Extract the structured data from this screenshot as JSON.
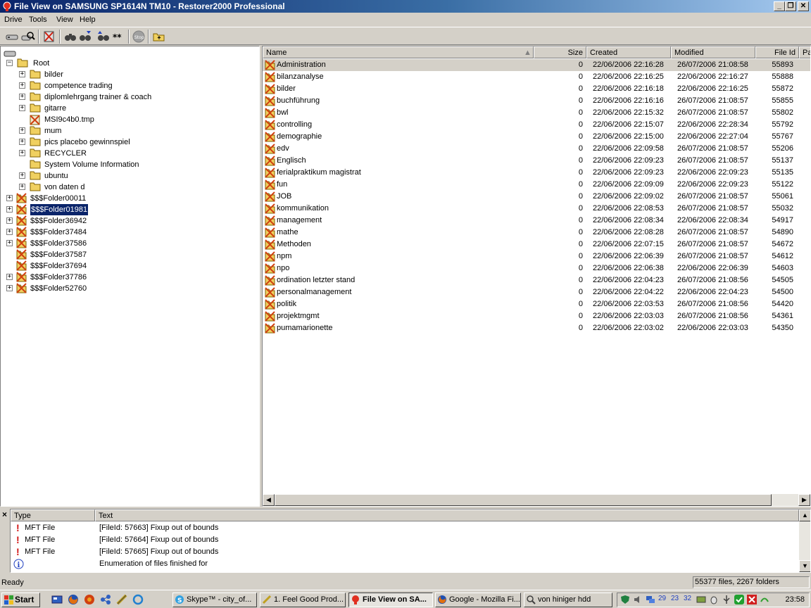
{
  "window": {
    "title": "File View  on SAMSUNG SP1614N TM10 - Restorer2000 Professional"
  },
  "menu": [
    "Drive",
    "Tools",
    "View",
    "Help"
  ],
  "tree": {
    "root": "Root",
    "root_children": [
      "bilder",
      "competence trading",
      "diplomlehrgang trainer & coach",
      "gitarre",
      "MSI9c4b0.tmp",
      "mum",
      "pics placebo gewinnspiel",
      "RECYCLER",
      "System Volume Information",
      "ubuntu",
      "von daten d"
    ],
    "lost": [
      "$$$Folder00011",
      "$$$Folder01981",
      "$$$Folder36942",
      "$$$Folder37484",
      "$$$Folder37586",
      "$$$Folder37587",
      "$$$Folder37694",
      "$$$Folder37786",
      "$$$Folder52760"
    ],
    "selected": "$$$Folder01981"
  },
  "list": {
    "columns": [
      "Name",
      "Size",
      "Created",
      "Modified",
      "File Id",
      "Pa"
    ],
    "rows": [
      [
        "Administration",
        "0",
        "22/06/2006 22:16:28",
        "26/07/2006 21:08:58",
        "55893"
      ],
      [
        "bilanzanalyse",
        "0",
        "22/06/2006 22:16:25",
        "22/06/2006 22:16:27",
        "55888"
      ],
      [
        "bilder",
        "0",
        "22/06/2006 22:16:18",
        "22/06/2006 22:16:25",
        "55872"
      ],
      [
        "buchführung",
        "0",
        "22/06/2006 22:16:16",
        "26/07/2006 21:08:57",
        "55855"
      ],
      [
        "bwl",
        "0",
        "22/06/2006 22:15:32",
        "26/07/2006 21:08:57",
        "55802"
      ],
      [
        "controlling",
        "0",
        "22/06/2006 22:15:07",
        "22/06/2006 22:28:34",
        "55792"
      ],
      [
        "demographie",
        "0",
        "22/06/2006 22:15:00",
        "22/06/2006 22:27:04",
        "55767"
      ],
      [
        "edv",
        "0",
        "22/06/2006 22:09:58",
        "26/07/2006 21:08:57",
        "55206"
      ],
      [
        "Englisch",
        "0",
        "22/06/2006 22:09:23",
        "26/07/2006 21:08:57",
        "55137"
      ],
      [
        "ferialpraktikum magistrat",
        "0",
        "22/06/2006 22:09:23",
        "22/06/2006 22:09:23",
        "55135"
      ],
      [
        "fun",
        "0",
        "22/06/2006 22:09:09",
        "22/06/2006 22:09:23",
        "55122"
      ],
      [
        "JOB",
        "0",
        "22/06/2006 22:09:02",
        "26/07/2006 21:08:57",
        "55061"
      ],
      [
        "kommunikation",
        "0",
        "22/06/2006 22:08:53",
        "26/07/2006 21:08:57",
        "55032"
      ],
      [
        "management",
        "0",
        "22/06/2006 22:08:34",
        "22/06/2006 22:08:34",
        "54917"
      ],
      [
        "mathe",
        "0",
        "22/06/2006 22:08:28",
        "26/07/2006 21:08:57",
        "54890"
      ],
      [
        "Methoden",
        "0",
        "22/06/2006 22:07:15",
        "26/07/2006 21:08:57",
        "54672"
      ],
      [
        "npm",
        "0",
        "22/06/2006 22:06:39",
        "26/07/2006 21:08:57",
        "54612"
      ],
      [
        "npo",
        "0",
        "22/06/2006 22:06:38",
        "22/06/2006 22:06:39",
        "54603"
      ],
      [
        "ordination letzter stand",
        "0",
        "22/06/2006 22:04:23",
        "26/07/2006 21:08:56",
        "54505"
      ],
      [
        "personalmanagement",
        "0",
        "22/06/2006 22:04:22",
        "22/06/2006 22:04:23",
        "54500"
      ],
      [
        "politik",
        "0",
        "22/06/2006 22:03:53",
        "26/07/2006 21:08:56",
        "54420"
      ],
      [
        "projektmgmt",
        "0",
        "22/06/2006 22:03:03",
        "26/07/2006 21:08:56",
        "54361"
      ],
      [
        "pumamarionette",
        "0",
        "22/06/2006 22:03:02",
        "22/06/2006 22:03:03",
        "54350"
      ]
    ]
  },
  "log": {
    "columns": [
      "Type",
      "Text"
    ],
    "rows": [
      {
        "icon": "error-icon",
        "type": "MFT File",
        "text": "[FileId: 57663] Fixup out of bounds"
      },
      {
        "icon": "error-icon",
        "type": "MFT File",
        "text": "[FileId: 57664] Fixup out of bounds"
      },
      {
        "icon": "error-icon",
        "type": "MFT File",
        "text": "[FileId: 57665] Fixup out of bounds"
      },
      {
        "icon": "info-icon",
        "type": "",
        "text": "Enumeration of files finished for"
      }
    ]
  },
  "status": {
    "left": "Ready",
    "right": "55377 files, 2267 folders"
  },
  "taskbar": {
    "start": "Start",
    "tasks": [
      "Skype™ - city_of...",
      "1. Feel Good Prod...",
      "File View  on SA...",
      "Google - Mozilla Fi...",
      "von hiniger hdd"
    ],
    "tray_numbers": [
      "29",
      "23",
      "32"
    ],
    "clock": "23:58"
  },
  "colors": {
    "selection": "#0a246a",
    "title_start": "#0a246a",
    "title_end": "#a6caf0",
    "deleted_mark": "#d04010"
  }
}
